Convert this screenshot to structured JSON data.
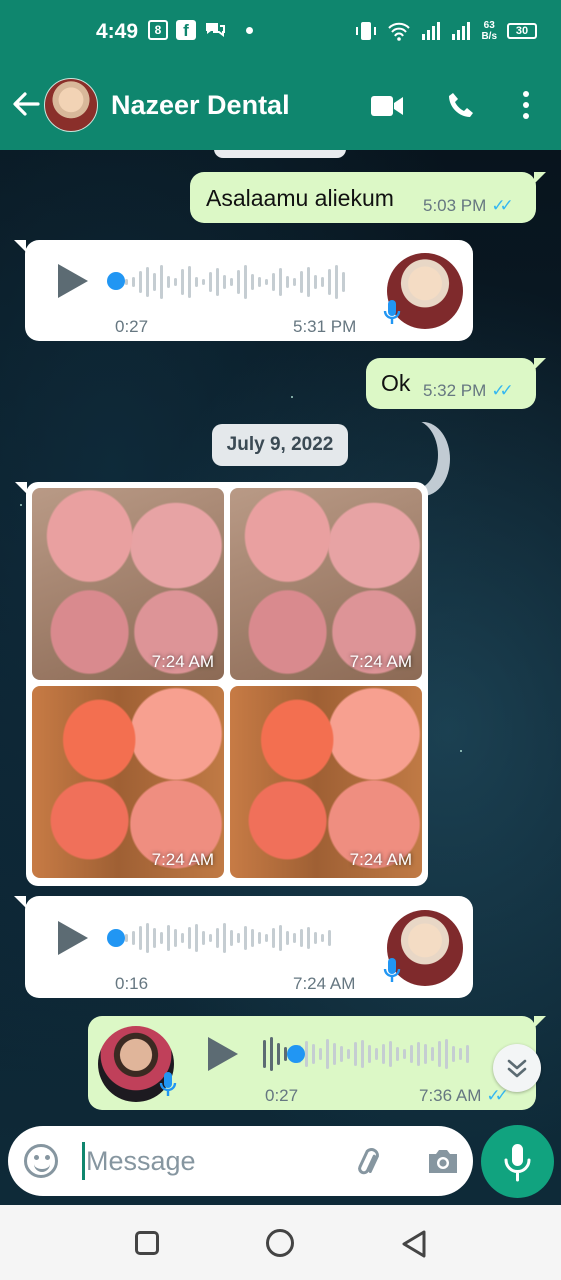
{
  "status_bar": {
    "time": "4:49",
    "net_speed_top": "63",
    "net_speed_bottom": "B/s",
    "battery": "30"
  },
  "header": {
    "contact_name": "Nazeer Dental",
    "icons": [
      "back-arrow-icon",
      "video-call-icon",
      "phone-call-icon",
      "more-vert-icon"
    ]
  },
  "messages": [
    {
      "type": "text",
      "direction": "outgoing",
      "text": "Asalaamu aliekum",
      "time": "5:03 PM",
      "status": "read"
    },
    {
      "type": "voice",
      "direction": "incoming",
      "duration": "0:27",
      "time": "5:31 PM"
    },
    {
      "type": "text",
      "direction": "outgoing",
      "text": "Ok",
      "time": "5:32 PM",
      "status": "read"
    },
    {
      "type": "date",
      "text": "July 9, 2022"
    },
    {
      "type": "image-album",
      "direction": "incoming",
      "times": [
        "7:24 AM",
        "7:24 AM",
        "7:24 AM",
        "7:24 AM"
      ]
    },
    {
      "type": "voice",
      "direction": "incoming",
      "duration": "0:16",
      "time": "7:24 AM"
    },
    {
      "type": "voice",
      "direction": "outgoing",
      "duration": "0:27",
      "time": "7:36 AM",
      "status": "read"
    }
  ],
  "input": {
    "placeholder": "Message"
  },
  "colors": {
    "brand": "#0f866e",
    "outgoing_bubble": "#dcf8c6",
    "read_tick": "#34b7f1",
    "mic_button": "#11a37f"
  }
}
